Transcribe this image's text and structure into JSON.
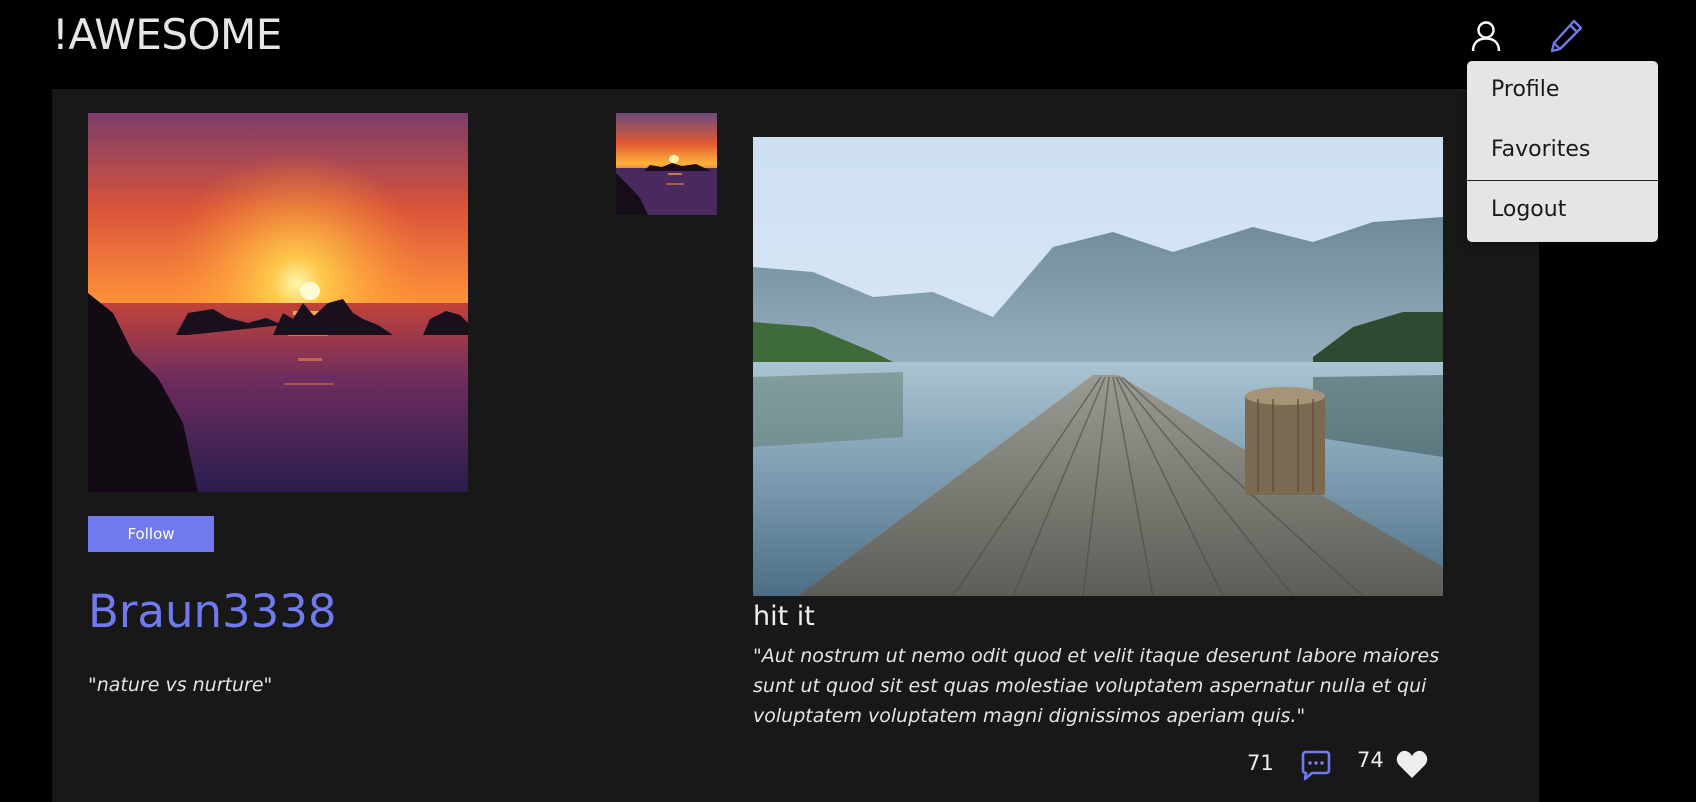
{
  "header": {
    "brand": "!AWESOME",
    "user_icon": "user-icon",
    "edit_icon": "pencil-icon",
    "accent_color": "#7179ee"
  },
  "profile": {
    "follow_label": "Follow",
    "username": "Braun3338",
    "bio": "\"nature vs nurture\""
  },
  "post": {
    "title": "hit it",
    "body": "\"Aut nostrum ut nemo odit quod et velit itaque deserunt labore maiores sunt ut quod sit est quas molestiae voluptatem aspernatur nulla et qui voluptatem voluptatem magni dignissimos aperiam quis.\"",
    "comments_count": "71",
    "likes_count": "74",
    "comment_icon": "speech-bubble-icon",
    "like_icon": "heart-icon"
  },
  "dropdown": {
    "items": [
      {
        "label": "Profile"
      },
      {
        "label": "Favorites"
      },
      {
        "label": "Logout"
      }
    ]
  },
  "colors": {
    "background": "#000000",
    "panel": "#181818",
    "accent": "#7179ee",
    "dropdown_bg": "#e6e5e3"
  }
}
